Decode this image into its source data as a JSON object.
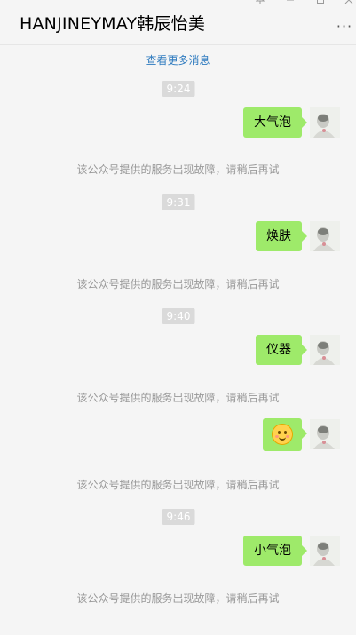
{
  "window": {
    "title": "HANJINEYMAY韩辰怡美",
    "more_label": "···"
  },
  "history": {
    "load_more": "查看更多消息"
  },
  "messages": [
    {
      "time": "9:24",
      "text": "大气泡",
      "notice": "该公众号提供的服务出现故障，请稍后再试"
    },
    {
      "time": "9:31",
      "text": "焕肤",
      "notice": "该公众号提供的服务出现故障，请稍后再试"
    },
    {
      "time": "9:40",
      "text": "仪器",
      "notice": "该公众号提供的服务出现故障，请稍后再试"
    },
    {
      "time": "",
      "text": "",
      "emoji": "smiling-blush-emoji",
      "notice": "该公众号提供的服务出现故障，请稍后再试"
    },
    {
      "time": "9:46",
      "text": "小气泡",
      "notice": "该公众号提供的服务出现故障，请稍后再试"
    }
  ],
  "colors": {
    "bubble": "#9eea6a",
    "link": "#2f7bbf",
    "system_text": "#999999",
    "background": "#f5f5f5"
  }
}
